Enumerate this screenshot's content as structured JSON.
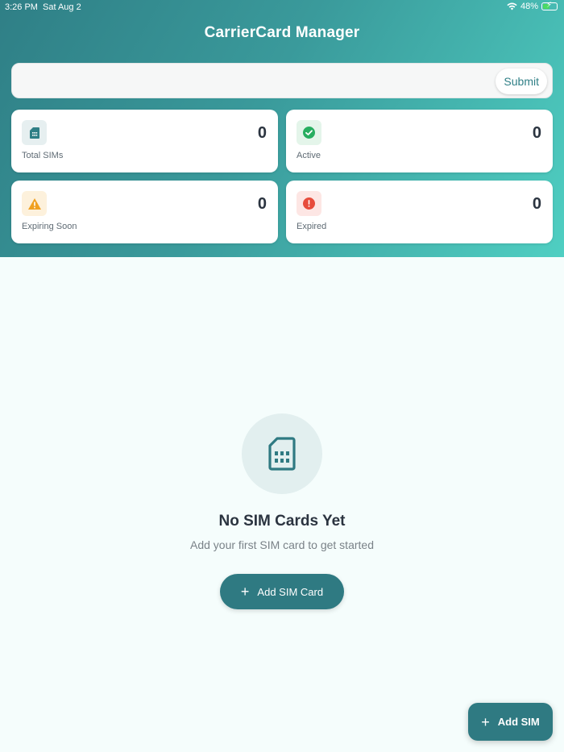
{
  "status_bar": {
    "time": "3:26 PM",
    "date": "Sat Aug 2",
    "battery": "48%",
    "icons": [
      "wifi-icon",
      "battery-charging-icon"
    ]
  },
  "header": {
    "title": "CarrierCard Manager"
  },
  "search": {
    "value": "",
    "submit_label": "Submit"
  },
  "stats": [
    {
      "label": "Total SIMs",
      "count": "0",
      "icon": "sim-card-icon",
      "color": "#2f7f86",
      "bg": "#e6eff0"
    },
    {
      "label": "Active",
      "count": "0",
      "icon": "check-circle-icon",
      "color": "#27ae60",
      "bg": "#e4f5ea"
    },
    {
      "label": "Expiring Soon",
      "count": "0",
      "icon": "warning-icon",
      "color": "#f0a020",
      "bg": "#fdf1dc"
    },
    {
      "label": "Expired",
      "count": "0",
      "icon": "error-icon",
      "color": "#e74c3c",
      "bg": "#fde6e4"
    }
  ],
  "empty_state": {
    "icon": "sim-card-icon",
    "title": "No SIM Cards Yet",
    "subtitle": "Add your first SIM card to get started",
    "button_label": "Add SIM Card"
  },
  "fab": {
    "label": "Add SIM"
  }
}
